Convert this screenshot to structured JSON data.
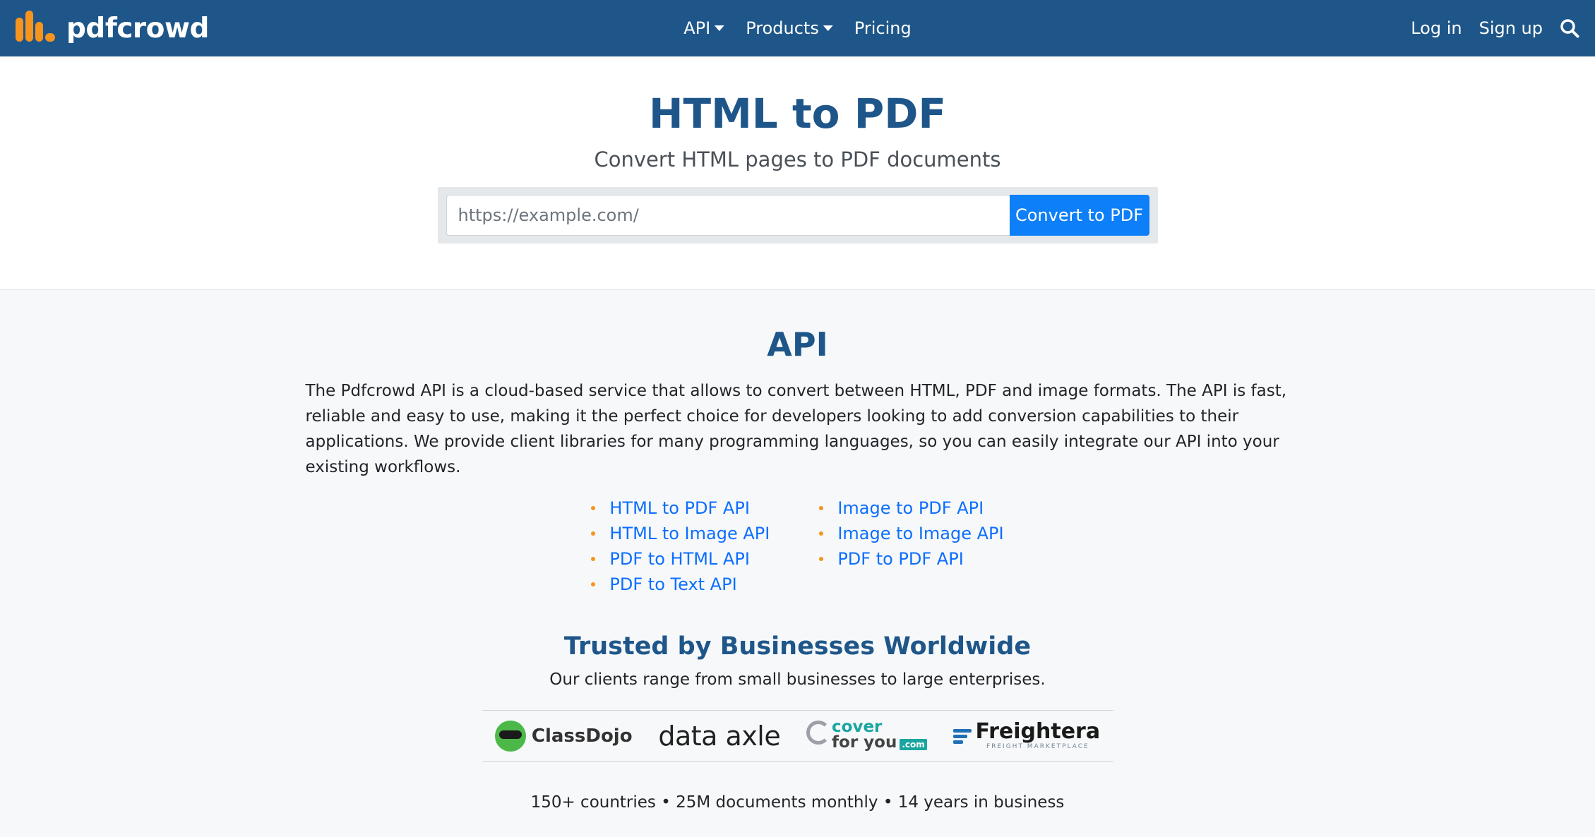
{
  "brand": {
    "name": "pdfcrowd",
    "accent": "#f7941d",
    "nav_bg": "#1f5689"
  },
  "nav": {
    "items": [
      {
        "label": "API",
        "dropdown": true
      },
      {
        "label": "Products",
        "dropdown": true
      },
      {
        "label": "Pricing",
        "dropdown": false
      }
    ],
    "login": "Log in",
    "signup": "Sign up",
    "search_icon": "search-icon"
  },
  "hero": {
    "title": "HTML to PDF",
    "subtitle": "Convert HTML pages to PDF documents",
    "input_placeholder": "https://example.com/",
    "button": "Convert to PDF"
  },
  "api": {
    "title": "API",
    "description": "The Pdfcrowd API is a cloud-based service that allows to convert between HTML, PDF and image formats. The API is fast, reliable and easy to use, making it the perfect choice for developers looking to add conversion capabilities to their applications. We provide client libraries for many programming languages, so you can easily integrate our API into your existing workflows.",
    "links_left": [
      "HTML to PDF API",
      "HTML to Image API",
      "PDF to HTML API",
      "PDF to Text API"
    ],
    "links_right": [
      "Image to PDF API",
      "Image to Image API",
      "PDF to PDF API"
    ]
  },
  "trusted": {
    "title": "Trusted by Businesses Worldwide",
    "subtitle": "Our clients range from small businesses to large enterprises.",
    "logos": {
      "classdojo": "ClassDojo",
      "dataaxle": "data axle",
      "coverforyou_line1": "cover",
      "coverforyou_line2": "for you",
      "coverforyou_com": ".com",
      "freightera": "Freightera",
      "freightera_tag": "FREIGHT MARKETPLACE"
    }
  },
  "stats": "150+ countries • 25M documents monthly • 14 years in business"
}
